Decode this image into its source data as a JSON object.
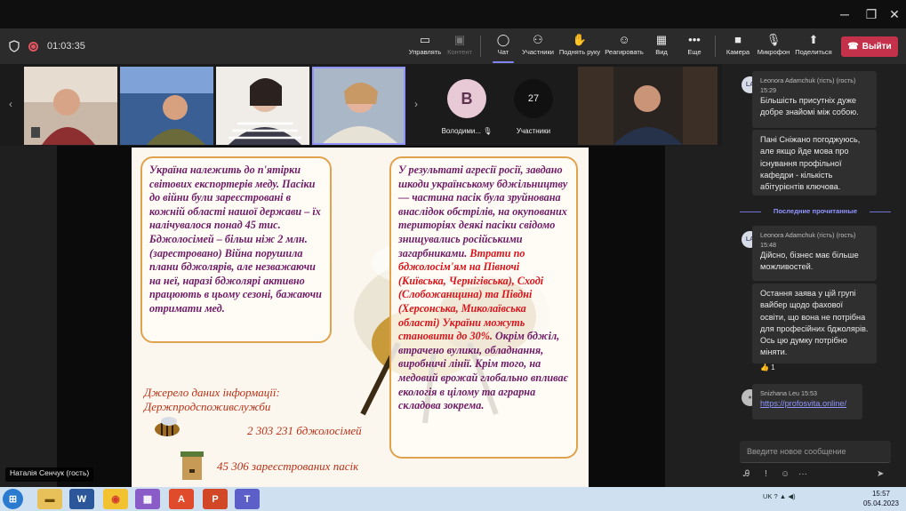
{
  "window": {
    "min_glyph": "─",
    "max_glyph": "❐",
    "close_glyph": "✕"
  },
  "toolbar": {
    "timer": "01:03:35",
    "buttons": [
      {
        "id": "share-view",
        "label": "Управлять",
        "icon": "share-screen-icon",
        "glyph": "▭"
      },
      {
        "id": "content",
        "label": "Контент",
        "icon": "content-icon",
        "glyph": "▣"
      },
      {
        "id": "chat",
        "label": "Чат",
        "icon": "chat-icon",
        "glyph": "◯"
      },
      {
        "id": "people",
        "label": "Участники",
        "icon": "people-icon",
        "glyph": "⚇"
      },
      {
        "id": "raise-hand",
        "label": "Поднять руку",
        "icon": "hand-icon",
        "glyph": "✋"
      },
      {
        "id": "react",
        "label": "Реагировать",
        "icon": "smile-icon",
        "glyph": "☺"
      },
      {
        "id": "view",
        "label": "Вид",
        "icon": "grid-icon",
        "glyph": "▦"
      },
      {
        "id": "more",
        "label": "Еще",
        "icon": "more-icon",
        "glyph": "•••"
      },
      {
        "id": "camera",
        "label": "Камера",
        "icon": "camera-icon",
        "glyph": "■"
      },
      {
        "id": "mic",
        "label": "Микрофон",
        "icon": "mic-off-icon",
        "glyph": "🎙"
      },
      {
        "id": "share",
        "label": "Поделиться",
        "icon": "share-up-icon",
        "glyph": "⬆"
      }
    ],
    "leave_label": "Выйти"
  },
  "participants": {
    "avatar_letter": "В",
    "avatar_name": "Володими...",
    "count": "27",
    "count_label": "Участники",
    "nav_left": "‹",
    "nav_right": "›"
  },
  "slide": {
    "left_box": "Україна належить до п'ятірки світових експортерів меду. Пасіки до війни були зареєстровані в кожній області нашої держави – їх налічувалося понад 45 тис. Бджолосімей – більш ніж 2 млн.(зарестровано) Війна порушила плани бджолярів, але незважаючи на неї, наразі бджолярі активно працюють в цьому сезоні, бажаючи отримати  мед.",
    "right_box_part1": "У результаті агресії росії, завдано шкоди українському бджільництву — частина пасік була зруйнована внаслідок обстрілів, на окупованих територіях деякі пасіки свідомо знищувались російськими загарбниками.",
    "right_box_red": "Втрати по бджолосім'ям на Півночі (Київська, Чернігівська), Сході (Слобожанщина) та Півдні (Херсонська, Миколаївська області) України можуть становити до 30%.",
    "right_box_part2": "Окрім бджіл, втрачено вулики, обладнання, виробничі лінії. Крім того, на медовий врожай глобально впливає екологія в цілому та аграрна складова зокрема.",
    "source_line1": "Джерело даних інформації:",
    "source_line2": "Держпродспоживслужби",
    "stat1": "2 303 231 бджолосімей",
    "stat2": "45 306 зареєстрованих пасік"
  },
  "presenter_label": "Наталія Сенчук (гость)",
  "chat": {
    "messages": [
      {
        "initials": "LA",
        "author": "Leonora Adamchuk (гість) (гость)",
        "time": "15:29",
        "text": "Більшість присутніх дуже добре знайомі між собою."
      },
      {
        "text": "Пані Сніжано погоджуюсь, але якщо йде мова про існування профільної кафедри - кількість абітурієнтів ключова."
      },
      {
        "initials": "LA",
        "author": "Leonora Adamchuk (гість) (гость)",
        "time": "15:48",
        "text": "Дійсно, бізнес має більше можливостей."
      },
      {
        "text": "Остання заява у цій групі вайбер щодо фахової освіти, що вона не потрібна для професійних бджолярів. Ось цю думку потрібно міняти.",
        "reaction": "👍 1"
      },
      {
        "initials": "",
        "author": "Snizhana Leu",
        "time": "15:53",
        "link": "https://profosvita.online/"
      }
    ],
    "divider": "Последние прочитанные",
    "compose_placeholder": "Введите новое сообщение"
  },
  "taskbar": {
    "apps": [
      {
        "name": "start-button",
        "glyph": "⊞",
        "bg": "#2a7ad0",
        "fg": "#ffffff"
      },
      {
        "name": "explorer-app",
        "glyph": "▬",
        "bg": "#e9c15b",
        "fg": "#6a4b00"
      },
      {
        "name": "word-app",
        "glyph": "W",
        "bg": "#2b579a",
        "fg": "#ffffff"
      },
      {
        "name": "chrome-app",
        "glyph": "◉",
        "bg": "#f2c230",
        "fg": "#d33c2c"
      },
      {
        "name": "tiles-app",
        "glyph": "▦",
        "bg": "#8a5cc8",
        "fg": "#ffffff"
      },
      {
        "name": "acrobat-app",
        "glyph": "A",
        "bg": "#e04b2b",
        "fg": "#ffffff"
      },
      {
        "name": "powerpoint-app",
        "glyph": "P",
        "bg": "#d24726",
        "fg": "#ffffff"
      },
      {
        "name": "teams-app",
        "glyph": "T",
        "bg": "#5b5fc7",
        "fg": "#ffffff"
      }
    ],
    "lang": "UK",
    "time": "15:57",
    "date": "05.04.2023"
  },
  "colors": {
    "accent": "#7f85f5",
    "leave": "#c4314b",
    "slide_text": "#6f1b66",
    "slide_red": "#d8151b"
  }
}
